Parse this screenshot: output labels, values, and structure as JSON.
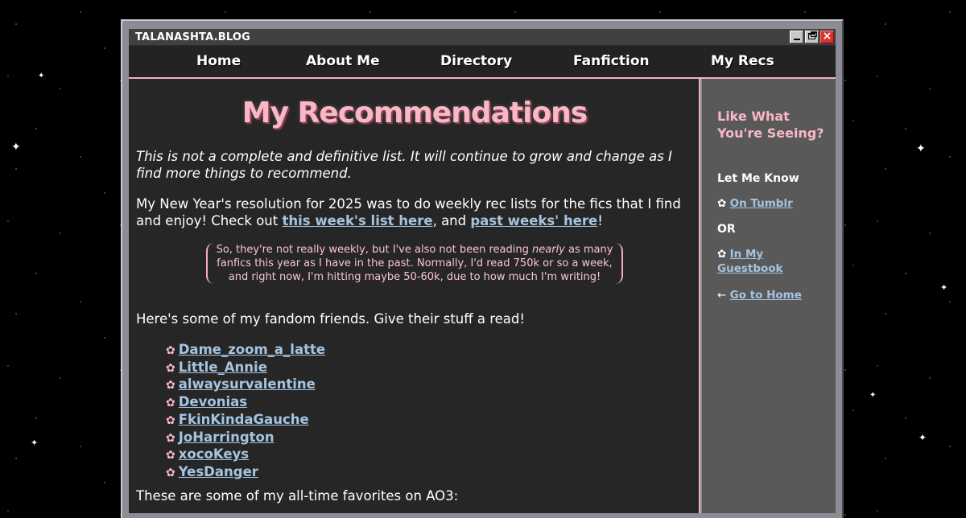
{
  "window": {
    "title": "TALANASHTA.BLOG",
    "controls": {
      "minimize_icon": "minimize-icon",
      "maximize_icon": "maximize-icon",
      "close_icon": "close-icon"
    }
  },
  "nav": {
    "items": [
      "Home",
      "About Me",
      "Directory",
      "Fanfiction",
      "My Recs"
    ]
  },
  "main": {
    "title": "My Recommendations",
    "intro_italic": "This is not a complete and definitive list. It will continue to grow and change as I find more things to recommend.",
    "resolution": {
      "text_before": "My New Year's resolution for 2025 was to do weekly rec lists for the fics that I find and enjoy! Check out ",
      "link1": "this week's list here",
      "text_middle": ", and ",
      "link2": "past weeks' here",
      "text_after": "!"
    },
    "note": {
      "before": "So, they're not really weekly, but I've also not been reading ",
      "emphasis": "nearly",
      "after": " as many fanfics this year as I have in the past. Normally, I'd read 750k or so a week, and right now, I'm hitting maybe 50-60k, due to how much I'm writing!"
    },
    "friends_intro": "Here's some of my fandom friends. Give their stuff a read!",
    "bullet_glyph": "✿",
    "friends": [
      "Dame_zoom_a_latte",
      "Little_Annie",
      "alwaysurvalentine",
      "Devonias",
      "FkinKindaGauche",
      "JoHarrington",
      "xocoKeys",
      "YesDanger"
    ],
    "favorites_intro": "These are some of my all-time favorites on AO3:"
  },
  "sidebar": {
    "heading": "Like What You're Seeing?",
    "let_me_know": "Let Me Know",
    "bullet_glyph": "✿",
    "tumblr_link": "On Tumblr",
    "or_text": "OR",
    "guestbook_link": "In My Guestbook",
    "arrow_glyph": "←",
    "home_link": "Go to Home"
  },
  "colors": {
    "accent_pink": "#f9b8c6",
    "link_blue": "#a5c4e0",
    "main_bg": "#262626",
    "sidebar_bg": "#595959",
    "close_red": "#e0302c"
  }
}
